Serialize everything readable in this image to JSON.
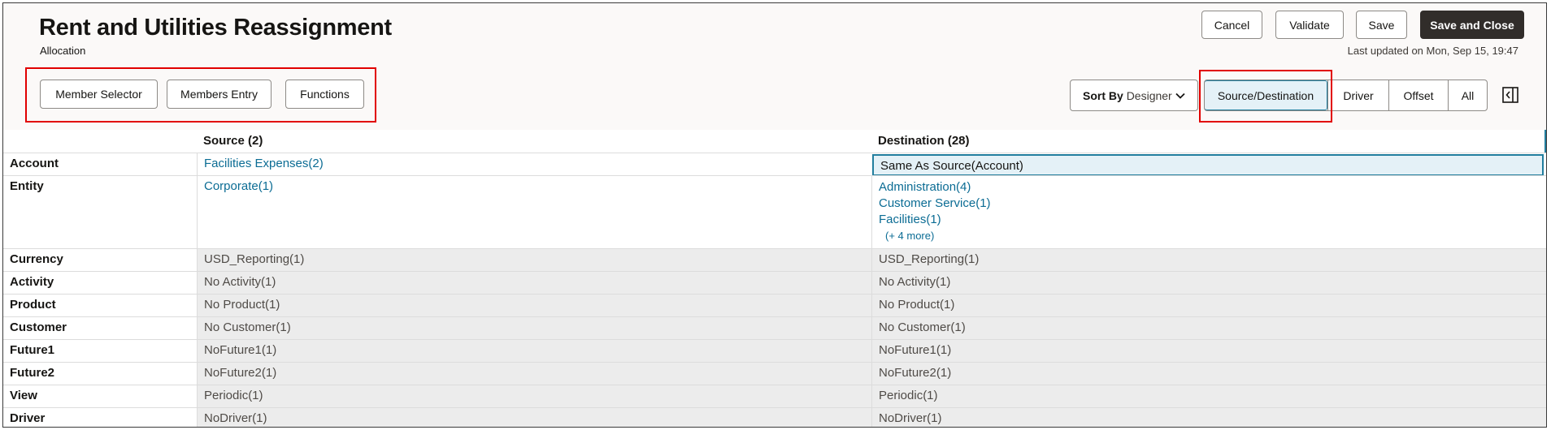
{
  "header": {
    "title": "Rent and Utilities Reassignment",
    "subtitle": "Allocation",
    "last_updated": "Last updated on Mon, Sep 15, 19:47"
  },
  "actions": {
    "cancel": "Cancel",
    "validate": "Validate",
    "save": "Save",
    "save_close": "Save and Close"
  },
  "toolbar": {
    "member_selector": "Member Selector",
    "members_entry": "Members Entry",
    "functions": "Functions",
    "sort_label": "Sort By",
    "sort_value": "Designer",
    "views": [
      "Source/Destination",
      "Driver",
      "Offset",
      "All"
    ],
    "selected_view": "Source/Destination"
  },
  "grid": {
    "source_header": "Source (2)",
    "destination_header": "Destination (28)",
    "rows": [
      {
        "label": "Account",
        "source": "Facilities Expenses(2)",
        "destination": "Same As Source(Account)"
      },
      {
        "label": "Entity",
        "source": "Corporate(1)",
        "destination": [
          "Administration(4)",
          "Customer Service(1)",
          "Facilities(1)"
        ],
        "more": "(+ 4 more)"
      },
      {
        "label": "Currency",
        "source": "USD_Reporting(1)",
        "destination": "USD_Reporting(1)"
      },
      {
        "label": "Activity",
        "source": "No Activity(1)",
        "destination": "No Activity(1)"
      },
      {
        "label": "Product",
        "source": "No Product(1)",
        "destination": "No Product(1)"
      },
      {
        "label": "Customer",
        "source": "No Customer(1)",
        "destination": "No Customer(1)"
      },
      {
        "label": "Future1",
        "source": "NoFuture1(1)",
        "destination": "NoFuture1(1)"
      },
      {
        "label": "Future2",
        "source": "NoFuture2(1)",
        "destination": "NoFuture2(1)"
      },
      {
        "label": "View",
        "source": "Periodic(1)",
        "destination": "Periodic(1)"
      },
      {
        "label": "Driver",
        "source": "NoDriver(1)",
        "destination": "NoDriver(1)"
      }
    ]
  },
  "colors": {
    "primary_button": "#312d2a",
    "link": "#0b6c94",
    "highlight": "#e10000",
    "selected_bg": "#e4f1f7"
  }
}
